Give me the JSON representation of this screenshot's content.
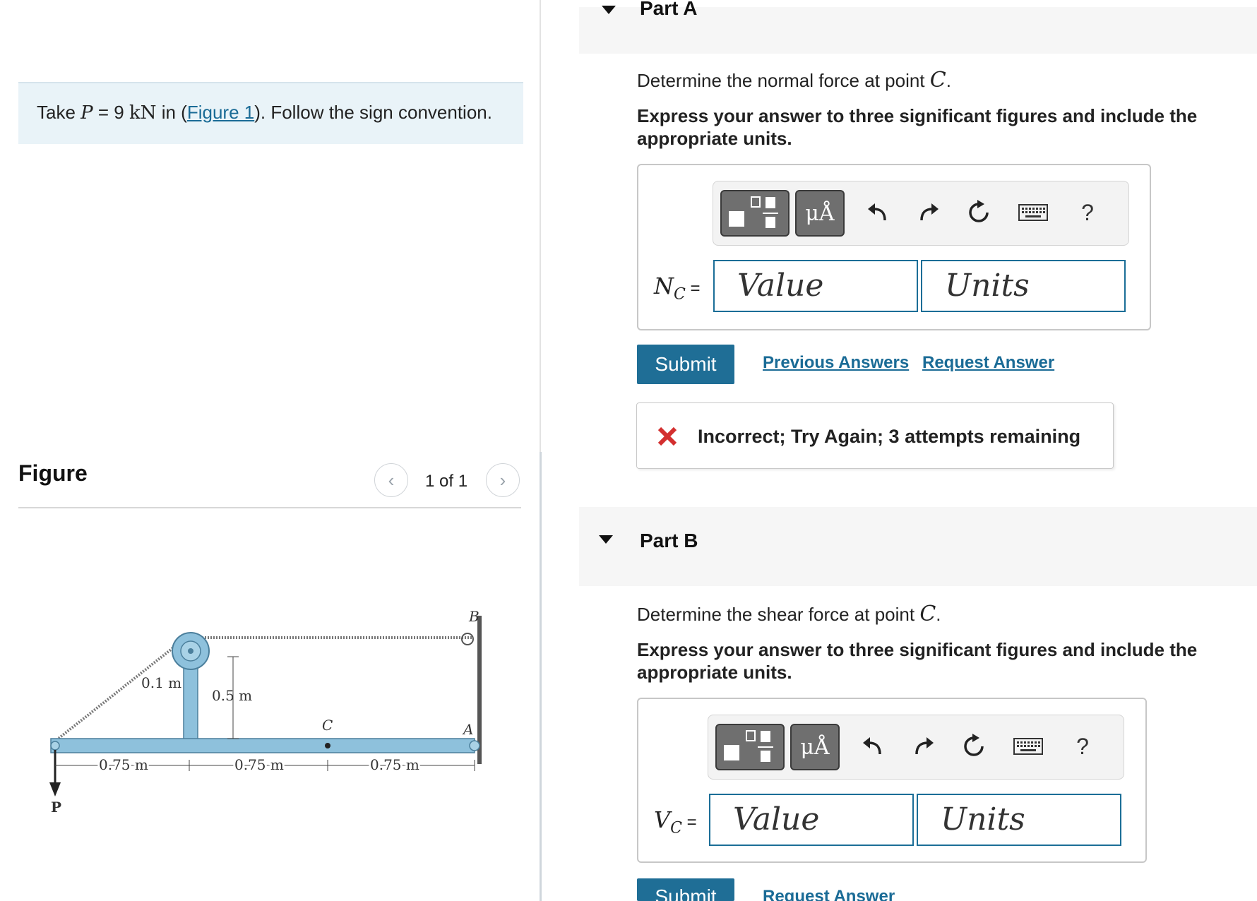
{
  "problem": {
    "prefix": "Take ",
    "var_P": "P",
    "equals": " = 9 ",
    "unit": "kN",
    "mid": " in (",
    "figure_link": "Figure 1",
    "suffix": "). Follow the sign convention."
  },
  "figure": {
    "heading": "Figure",
    "pager": "1 of 1",
    "labels": {
      "B": "B",
      "A": "A",
      "C": "C",
      "P": "P",
      "r": "0.1 m",
      "h": "0.5 m",
      "d1": "0.75 m",
      "d2": "0.75 m",
      "d3": "0.75 m"
    }
  },
  "partA": {
    "title": "Part A",
    "question_prefix": "Determine the normal force at point ",
    "question_var": "C",
    "question_suffix": ".",
    "instruction": "Express your answer to three significant figures and include the appropriate units.",
    "var_main": "N",
    "var_sub": "C",
    "var_eq": " =",
    "value_placeholder": "Value",
    "units_placeholder": "Units",
    "submit": "Submit",
    "previous_answers": "Previous Answers",
    "request_answer": "Request Answer",
    "feedback": "Incorrect; Try Again; 3 attempts remaining"
  },
  "partB": {
    "title": "Part B",
    "question_prefix": "Determine the shear force at point ",
    "question_var": "C",
    "question_suffix": ".",
    "instruction": "Express your answer to three significant figures and include the appropriate units.",
    "var_main": "V",
    "var_sub": "C",
    "var_eq": " =",
    "value_placeholder": "Value",
    "units_placeholder": "Units",
    "submit": "Submit",
    "request_answer": "Request Answer"
  },
  "toolbar": {
    "units_button": "μÅ",
    "help": "?",
    "icons": [
      "fraction-template-icon",
      "units-icon",
      "undo-icon",
      "redo-icon",
      "reset-icon",
      "keyboard-icon",
      "help-icon"
    ]
  },
  "colors": {
    "accent": "#1f6e96",
    "link": "#1a6b96",
    "error": "#d32f2f",
    "problem_bg": "#e9f3f8",
    "beam": "#8ec1dc"
  }
}
